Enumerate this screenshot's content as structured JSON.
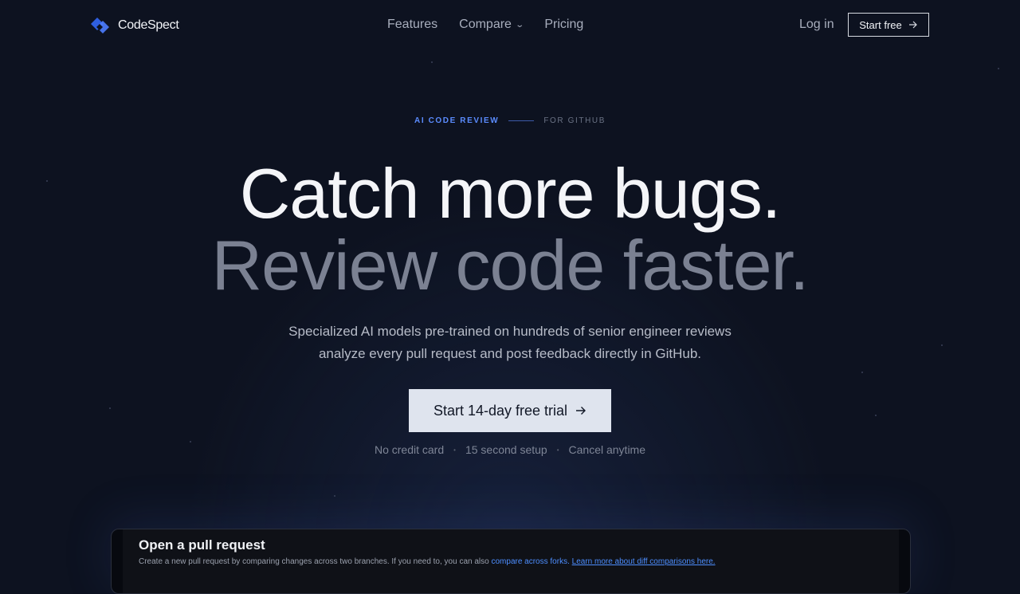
{
  "nav": {
    "brand": "CodeSpect",
    "links": [
      {
        "label": "Features"
      },
      {
        "label": "Compare"
      },
      {
        "label": "Pricing"
      }
    ],
    "login": "Log in",
    "start_free": "Start free"
  },
  "hero": {
    "eyebrow_primary": "AI CODE REVIEW",
    "eyebrow_secondary": "FOR GITHUB",
    "headline_1": "Catch more bugs.",
    "headline_2": "Review code faster.",
    "sub_line_1": "Specialized AI models pre-trained on hundreds of senior engineer reviews",
    "sub_line_2": "analyze every pull request and post feedback directly in GitHub.",
    "cta_label": "Start 14-day free trial",
    "perks": [
      "No credit card",
      "15 second setup",
      "Cancel anytime"
    ]
  },
  "preview": {
    "title": "Open a pull request",
    "desc_text": "Create a new pull request by comparing changes across two branches. If you need to, you can also",
    "desc_link_1": "compare across forks.",
    "desc_link_2": "Learn more about diff comparisons here."
  },
  "colors": {
    "background": "#0d1220",
    "accent": "#5b8cff",
    "cta_bg": "#dfe4ee"
  },
  "icons": {
    "logo": "diamond-logo-icon",
    "compare_chevron": "chevron-down-icon",
    "arrow": "arrow-right-icon"
  }
}
